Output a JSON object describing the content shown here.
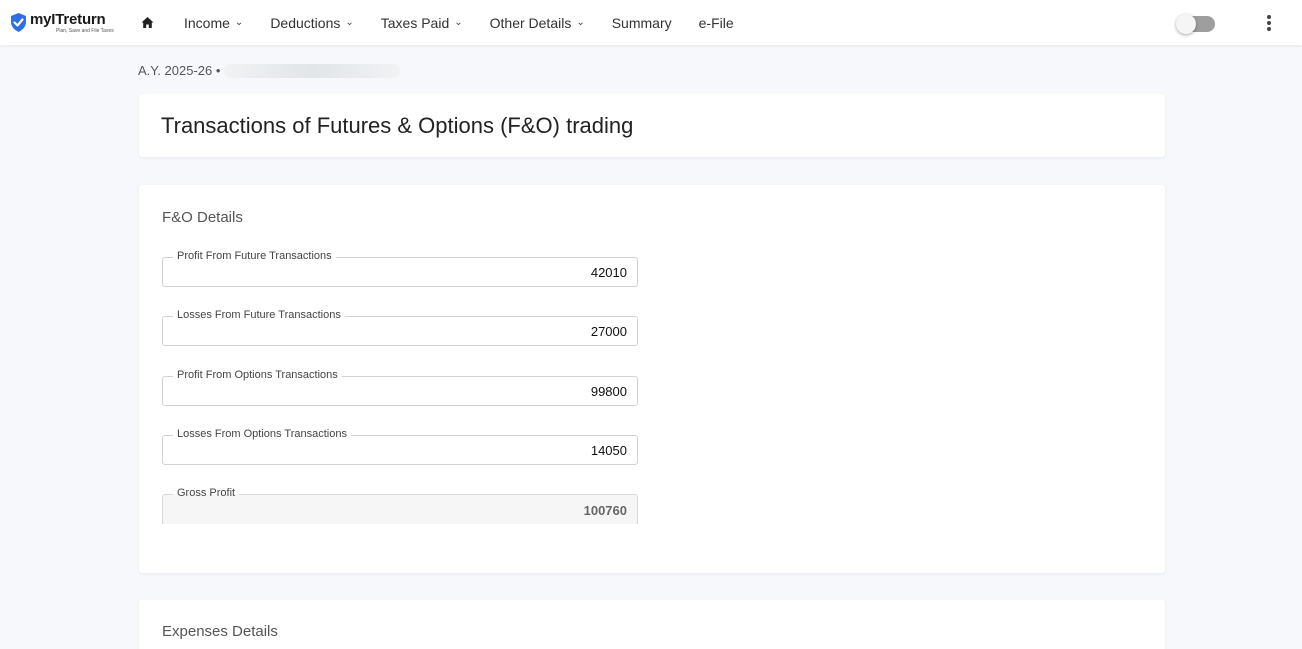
{
  "brand": {
    "name": "myITreturn",
    "tagline": "Plan, Save and File Taxes",
    "color": "#2f6fe4"
  },
  "nav": {
    "items": [
      {
        "label": "Income",
        "has_dropdown": true
      },
      {
        "label": "Deductions",
        "has_dropdown": true
      },
      {
        "label": "Taxes Paid",
        "has_dropdown": true
      },
      {
        "label": "Other Details",
        "has_dropdown": true
      },
      {
        "label": "Summary",
        "has_dropdown": false
      },
      {
        "label": "e-File",
        "has_dropdown": false
      }
    ]
  },
  "breadcrumb": {
    "assessment_year": "A.Y. 2025-26 •"
  },
  "page": {
    "title": "Transactions of Futures & Options (F&O) trading"
  },
  "fo_details": {
    "heading": "F&O Details",
    "fields": [
      {
        "label": "Profit From Future Transactions",
        "value": "42010"
      },
      {
        "label": "Losses From Future Transactions",
        "value": "27000"
      },
      {
        "label": "Profit From Options Transactions",
        "value": "99800"
      },
      {
        "label": "Losses From Options Transactions",
        "value": "14050"
      }
    ],
    "gross_profit": {
      "label": "Gross Profit",
      "value": "100760"
    }
  },
  "expenses": {
    "heading": "Expenses Details"
  }
}
